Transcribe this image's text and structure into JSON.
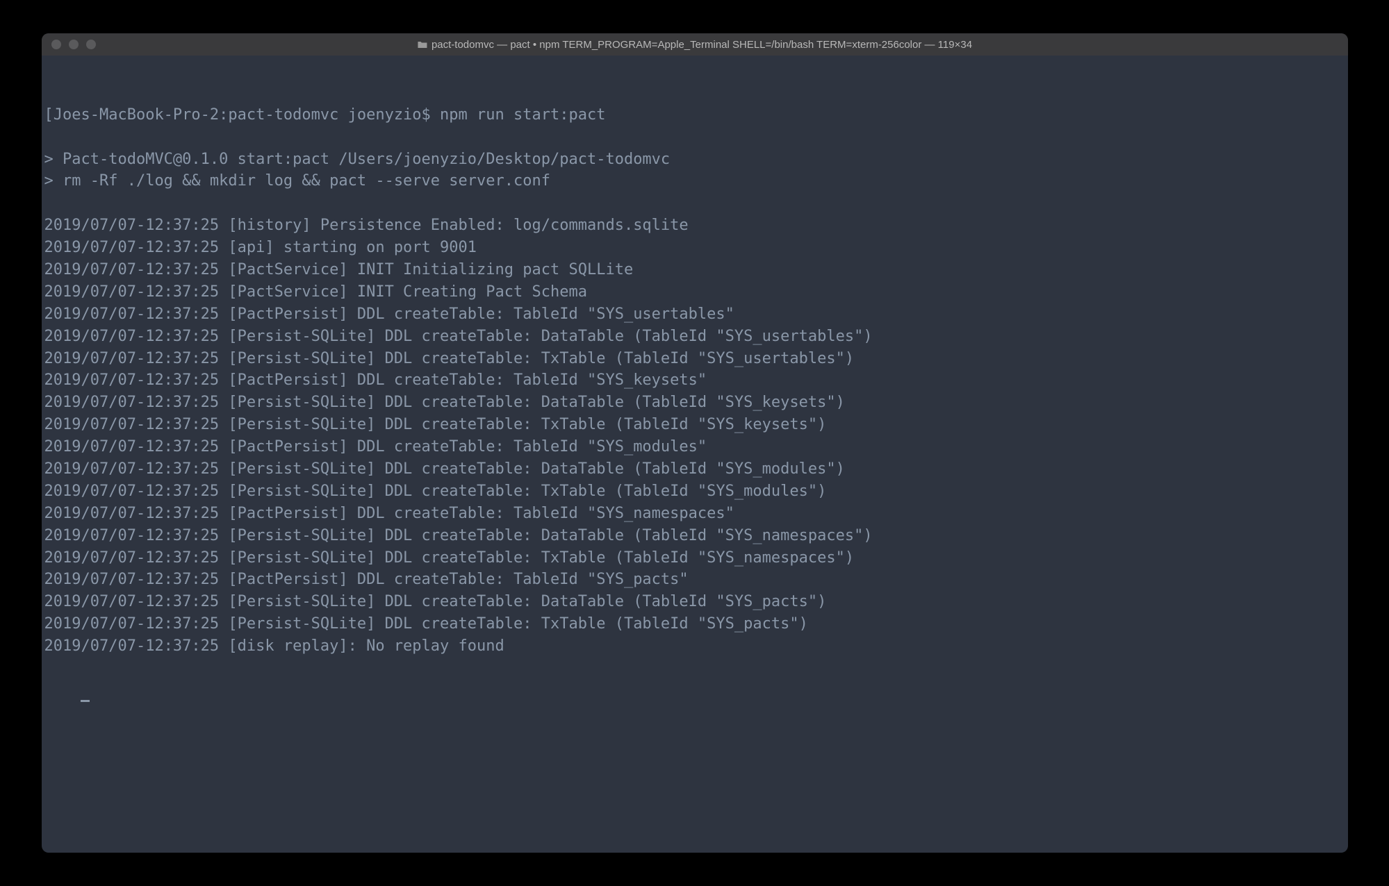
{
  "window": {
    "title": "pact-todomvc — pact • npm TERM_PROGRAM=Apple_Terminal SHELL=/bin/bash TERM=xterm-256color — 119×34"
  },
  "terminal": {
    "lines": [
      "[Joes-MacBook-Pro-2:pact-todomvc joenyzio$ npm run start:pact",
      "",
      "> Pact-todoMVC@0.1.0 start:pact /Users/joenyzio/Desktop/pact-todomvc",
      "> rm -Rf ./log && mkdir log && pact --serve server.conf",
      "",
      "2019/07/07-12:37:25 [history] Persistence Enabled: log/commands.sqlite",
      "2019/07/07-12:37:25 [api] starting on port 9001",
      "2019/07/07-12:37:25 [PactService] INIT Initializing pact SQLLite",
      "2019/07/07-12:37:25 [PactService] INIT Creating Pact Schema",
      "2019/07/07-12:37:25 [PactPersist] DDL createTable: TableId \"SYS_usertables\"",
      "2019/07/07-12:37:25 [Persist-SQLite] DDL createTable: DataTable (TableId \"SYS_usertables\")",
      "2019/07/07-12:37:25 [Persist-SQLite] DDL createTable: TxTable (TableId \"SYS_usertables\")",
      "2019/07/07-12:37:25 [PactPersist] DDL createTable: TableId \"SYS_keysets\"",
      "2019/07/07-12:37:25 [Persist-SQLite] DDL createTable: DataTable (TableId \"SYS_keysets\")",
      "2019/07/07-12:37:25 [Persist-SQLite] DDL createTable: TxTable (TableId \"SYS_keysets\")",
      "2019/07/07-12:37:25 [PactPersist] DDL createTable: TableId \"SYS_modules\"",
      "2019/07/07-12:37:25 [Persist-SQLite] DDL createTable: DataTable (TableId \"SYS_modules\")",
      "2019/07/07-12:37:25 [Persist-SQLite] DDL createTable: TxTable (TableId \"SYS_modules\")",
      "2019/07/07-12:37:25 [PactPersist] DDL createTable: TableId \"SYS_namespaces\"",
      "2019/07/07-12:37:25 [Persist-SQLite] DDL createTable: DataTable (TableId \"SYS_namespaces\")",
      "2019/07/07-12:37:25 [Persist-SQLite] DDL createTable: TxTable (TableId \"SYS_namespaces\")",
      "2019/07/07-12:37:25 [PactPersist] DDL createTable: TableId \"SYS_pacts\"",
      "2019/07/07-12:37:25 [Persist-SQLite] DDL createTable: DataTable (TableId \"SYS_pacts\")",
      "2019/07/07-12:37:25 [Persist-SQLite] DDL createTable: TxTable (TableId \"SYS_pacts\")",
      "2019/07/07-12:37:25 [disk replay]: No replay found"
    ]
  }
}
